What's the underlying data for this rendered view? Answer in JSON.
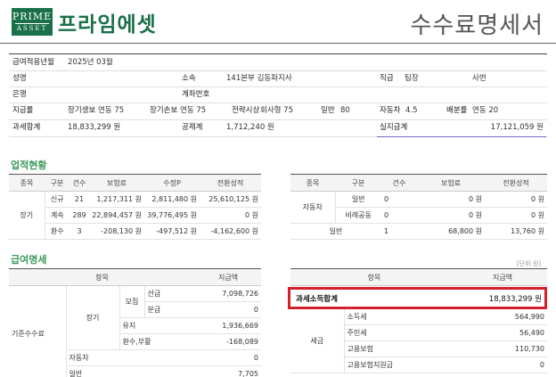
{
  "header": {
    "logo_line1": "PRIME",
    "logo_line2": "ASSET",
    "company": "프라임에셋",
    "doc_title": "수수료명세서"
  },
  "info": {
    "period_label": "급여적용년월",
    "period_value": "2025년 03월",
    "name_label": "성명",
    "name_value": "",
    "dept_label": "소속",
    "dept_value": "141본부 김동파지사",
    "rank_label": "직급",
    "rank_value": "팀장",
    "duty_value": "사번",
    "bank_label": "은행",
    "bank_value": "",
    "account_label": "계좌번호",
    "account_value": "",
    "r4_label1": "지급률",
    "r4_label2": "장기생보",
    "r4_val2": "연동 75",
    "r4_label3": "장기손보",
    "r4_val3": "연동 75",
    "r4_label4": "전략시상",
    "r4_val4": "회사형 75",
    "r4_label5": "일반",
    "r4_val5": "80",
    "r4_label6": "자동차",
    "r4_val6": "4.5",
    "r4_label7": "배분률",
    "r4_val7": "연동 20",
    "total_label": "과세합계",
    "total_value": "18,833,299 원",
    "deduct_label": "공제계",
    "deduct_value": "1,712,240 원",
    "pay_label": "실지급계",
    "pay_value": "17,121,059 원"
  },
  "perf": {
    "title": "업적현황",
    "headers": [
      "종목",
      "구분",
      "건수",
      "보험료",
      "수정P",
      "전환성적"
    ],
    "group": "장기",
    "rows": [
      [
        "신규",
        "21",
        "1,217,311 원",
        "2,811,480 원",
        "25,610,125 원"
      ],
      [
        "계속",
        "289",
        "22,894,457 원",
        "39,776,495 원",
        "0 원"
      ],
      [
        "환수",
        "3",
        "-208,130 원",
        "-497,512 원",
        "-4,162,600 원"
      ]
    ],
    "right_headers": [
      "종목",
      "구분",
      "건수",
      "보험료",
      "전환성적"
    ],
    "right_group": "자동차",
    "right_rows": [
      [
        "일반",
        "0",
        "0 원",
        "0 원"
      ],
      [
        "비례공동",
        "0",
        "0 원",
        "0 원"
      ]
    ],
    "right_general": [
      "일반",
      "1",
      "68,800 원",
      "13,760 원"
    ]
  },
  "pay": {
    "title": "급여명세",
    "unit": "[단위:원]",
    "headers": [
      "항목",
      "지급액"
    ],
    "group": "기준수수료",
    "sub_long": "장기",
    "sub_recruit": "모집",
    "rows": [
      {
        "label": "선급",
        "value": "7,098,726"
      },
      {
        "label": "분급",
        "value": "0"
      },
      {
        "label": "유지",
        "value": "1,936,669"
      },
      {
        "label": "환수,부활",
        "value": "-168,089"
      },
      {
        "label": "자동차",
        "value": "0"
      },
      {
        "label": "일반",
        "value": "7,705"
      }
    ],
    "right_headers": [
      "항목",
      "지급액"
    ],
    "taxable_label": "과세소득합계",
    "taxable_value": "18,833,299 원",
    "tax_group": "세금",
    "tax_rows": [
      {
        "label": "소득세",
        "value": "564,990"
      },
      {
        "label": "주민세",
        "value": "56,490"
      },
      {
        "label": "고용보험",
        "value": "110,730"
      },
      {
        "label": "고용보험지원금",
        "value": "0"
      }
    ]
  },
  "colors": {
    "brand": "#1a7048",
    "section": "#3a9a5a",
    "highlight": "#d4202c",
    "purple_line": "#7a5fc0"
  }
}
